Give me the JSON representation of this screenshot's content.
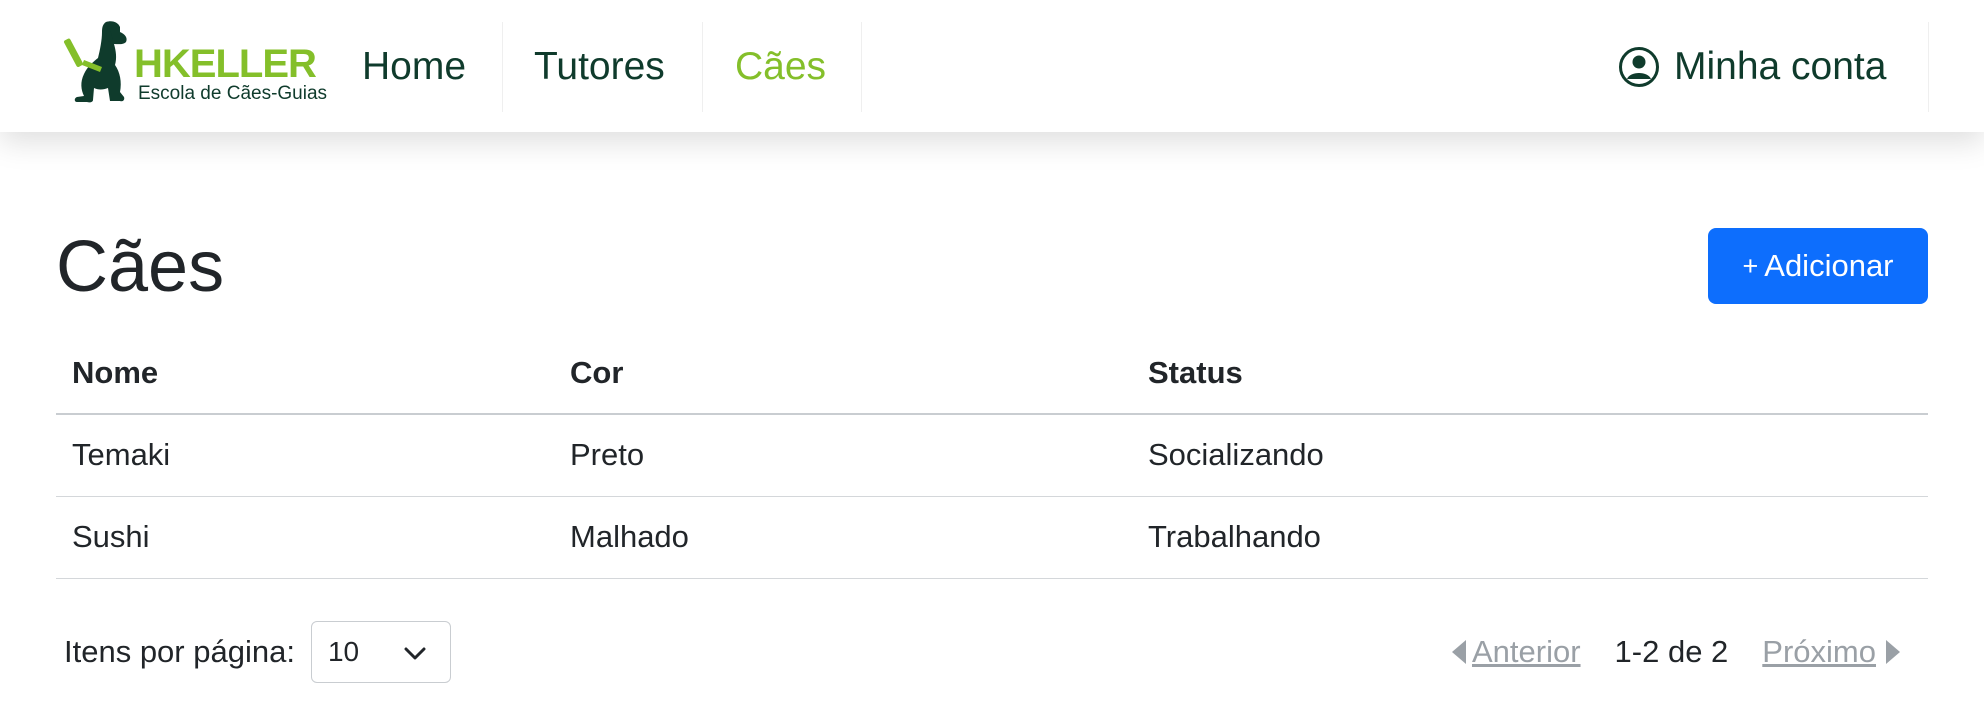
{
  "brand": {
    "name": "HKELLER",
    "tagline": "Escola de Cães-Guias",
    "logo_icon": "guide-dog-icon"
  },
  "nav": {
    "items": [
      {
        "label": "Home",
        "active": false
      },
      {
        "label": "Tutores",
        "active": false
      },
      {
        "label": "Cães",
        "active": true
      }
    ],
    "account": {
      "label": "Minha conta",
      "icon": "user-circle-icon"
    }
  },
  "page": {
    "title": "Cães",
    "add_button": {
      "plus": "+",
      "label": "Adicionar"
    }
  },
  "table": {
    "columns": [
      "Nome",
      "Cor",
      "Status"
    ],
    "rows": [
      [
        "Temaki",
        "Preto",
        "Socializando"
      ],
      [
        "Sushi",
        "Malhado",
        "Trabalhando"
      ]
    ]
  },
  "pagination": {
    "per_page_label": "Itens por página:",
    "per_page_value": "10",
    "prev_label": "Anterior",
    "range_text": "1-2 de 2",
    "next_label": "Próximo"
  },
  "colors": {
    "brand_green": "#84bf2a",
    "brand_dark": "#0f3b2c",
    "primary": "#0d6efd",
    "muted": "#9aa0a6"
  }
}
